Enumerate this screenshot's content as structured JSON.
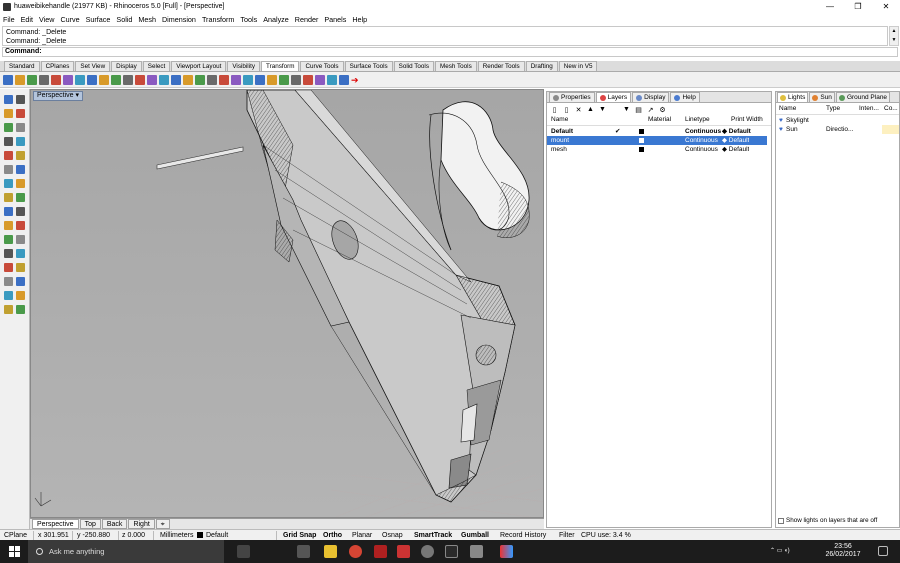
{
  "window": {
    "title": "huaweibikehandle (21977 KB) - Rhinoceros 5.0 [Full] - [Perspective]",
    "minimize": "—",
    "maximize": "❐",
    "close": "✕"
  },
  "menu": [
    "File",
    "Edit",
    "View",
    "Curve",
    "Surface",
    "Solid",
    "Mesh",
    "Dimension",
    "Transform",
    "Tools",
    "Analyze",
    "Render",
    "Panels",
    "Help"
  ],
  "command": {
    "history": [
      "Command: _Delete",
      "Command: _Delete"
    ],
    "prompt": "Command:"
  },
  "toolbar_tabs": [
    "Standard",
    "CPlanes",
    "Set View",
    "Display",
    "Select",
    "Viewport Layout",
    "Visibility",
    "Transform",
    "Curve Tools",
    "Surface Tools",
    "Solid Tools",
    "Mesh Tools",
    "Render Tools",
    "Drafting",
    "New in V5"
  ],
  "toolbar_active_tab": "Transform",
  "viewport": {
    "label": "Perspective",
    "dropdown": "▾",
    "tabs": [
      "Perspective",
      "Top",
      "Back",
      "Right",
      "⌖"
    ],
    "active_tab": "Perspective"
  },
  "layers_panel": {
    "tabs": [
      "Properties",
      "Layers",
      "Display",
      "Help"
    ],
    "active_tab": "Layers",
    "tool_glyphs": [
      "▯",
      "▯",
      "✕",
      "▲",
      "▼",
      "",
      "▼",
      "▤",
      "↗",
      "⚙"
    ],
    "columns": [
      "Name",
      "Material",
      "Linetype",
      "Print Width"
    ],
    "rows": [
      {
        "name": "Default",
        "current": "✔",
        "linetype": "Continuous",
        "print_width": "◆ Default",
        "selected": false,
        "bold": true
      },
      {
        "name": "mount",
        "current": "",
        "linetype": "Continuous",
        "print_width": "◆ Default",
        "selected": true,
        "bold": false
      },
      {
        "name": "mesh",
        "current": "",
        "linetype": "Continuous",
        "print_width": "◆ Default",
        "selected": false,
        "bold": false
      }
    ]
  },
  "lights_panel": {
    "tabs": [
      "Lights",
      "Sun",
      "Ground Plane"
    ],
    "columns": [
      "Name",
      "Type",
      "Inten...",
      "Co..."
    ],
    "rows": [
      {
        "name": "Skylight",
        "type": ""
      },
      {
        "name": "Sun",
        "type": "Directio..."
      }
    ],
    "checkbox_label": "Show lights on layers that are off"
  },
  "status": {
    "cplane": "CPlane",
    "x": "x 301.951",
    "y": "y -250.880",
    "z": "z 0.000",
    "units": "Millimeters",
    "layer": "Default",
    "toggles": [
      "Grid Snap",
      "Ortho",
      "Planar",
      "Osnap",
      "SmartTrack",
      "Gumball",
      "Record History",
      "Filter"
    ],
    "bold_toggles": [
      "Grid Snap",
      "Ortho",
      "SmartTrack",
      "Gumball"
    ],
    "cpu": "CPU use: 3.4 %"
  },
  "taskbar": {
    "search_placeholder": "Ask me anything",
    "time": "23:56",
    "date": "26/02/2017"
  },
  "colors": {
    "viewport_bg": "#a6a6a6",
    "selection": "#3a78d2",
    "taskbar": "#1c1c1c"
  }
}
